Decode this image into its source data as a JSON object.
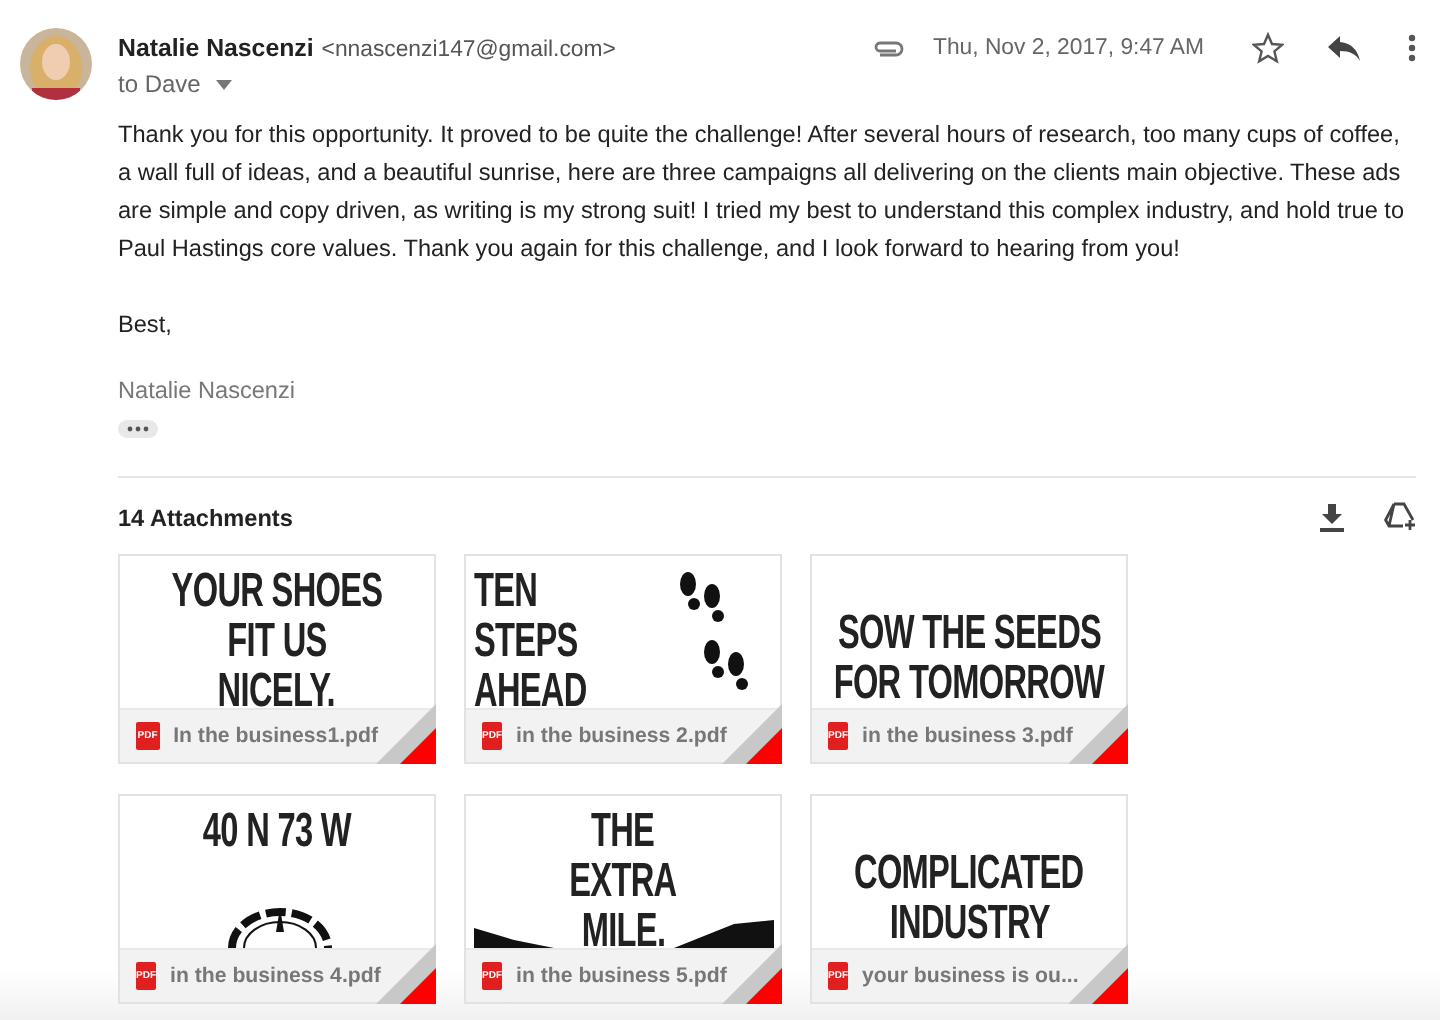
{
  "sender": {
    "name": "Natalie Nascenzi",
    "email": "<nnascenzi147@gmail.com>"
  },
  "recipient": "to Dave",
  "date": "Thu, Nov 2, 2017, 9:47 AM",
  "starred": false,
  "body": [
    "Thank you for this opportunity. It proved to be quite the challenge! After several hours of research, too many cups of coffee, a wall full of ideas, and a beautiful sunrise, here are three campaigns all delivering on the clients main objective. These ads are simple and copy driven, as writing is my strong suit! I tried my best to understand this complex industry, and hold true to Paul Hastings core values. Thank you again for this challenge, and I look forward to hearing from you!",
    "Best,"
  ],
  "signature": "Natalie Nascenzi",
  "attachments": {
    "title": "14 Attachments",
    "items": [
      {
        "filename": "In the business1.pdf",
        "badge": "PDF",
        "preview": [
          "YOUR SHOES",
          "FIT US",
          "NICELY."
        ],
        "kind": "top"
      },
      {
        "filename": "in the business 2.pdf",
        "badge": "PDF",
        "preview": [
          "TEN",
          "STEPS",
          "AHEAD"
        ],
        "kind": "footprints"
      },
      {
        "filename": "in the business 3.pdf",
        "badge": "PDF",
        "preview": [
          "SOW THE SEEDS",
          "FOR TOMORROW"
        ],
        "kind": "low"
      },
      {
        "filename": "in the business 4.pdf",
        "badge": "PDF",
        "preview": [
          "40 N 73 W"
        ],
        "kind": "compass"
      },
      {
        "filename": "in the business 5.pdf",
        "badge": "PDF",
        "preview": [
          "THE",
          "EXTRA",
          "MILE."
        ],
        "kind": "hills"
      },
      {
        "filename": "your business is ou...",
        "badge": "PDF",
        "preview": [
          "COMPLICATED",
          "INDUSTRY"
        ],
        "kind": "low"
      }
    ]
  }
}
